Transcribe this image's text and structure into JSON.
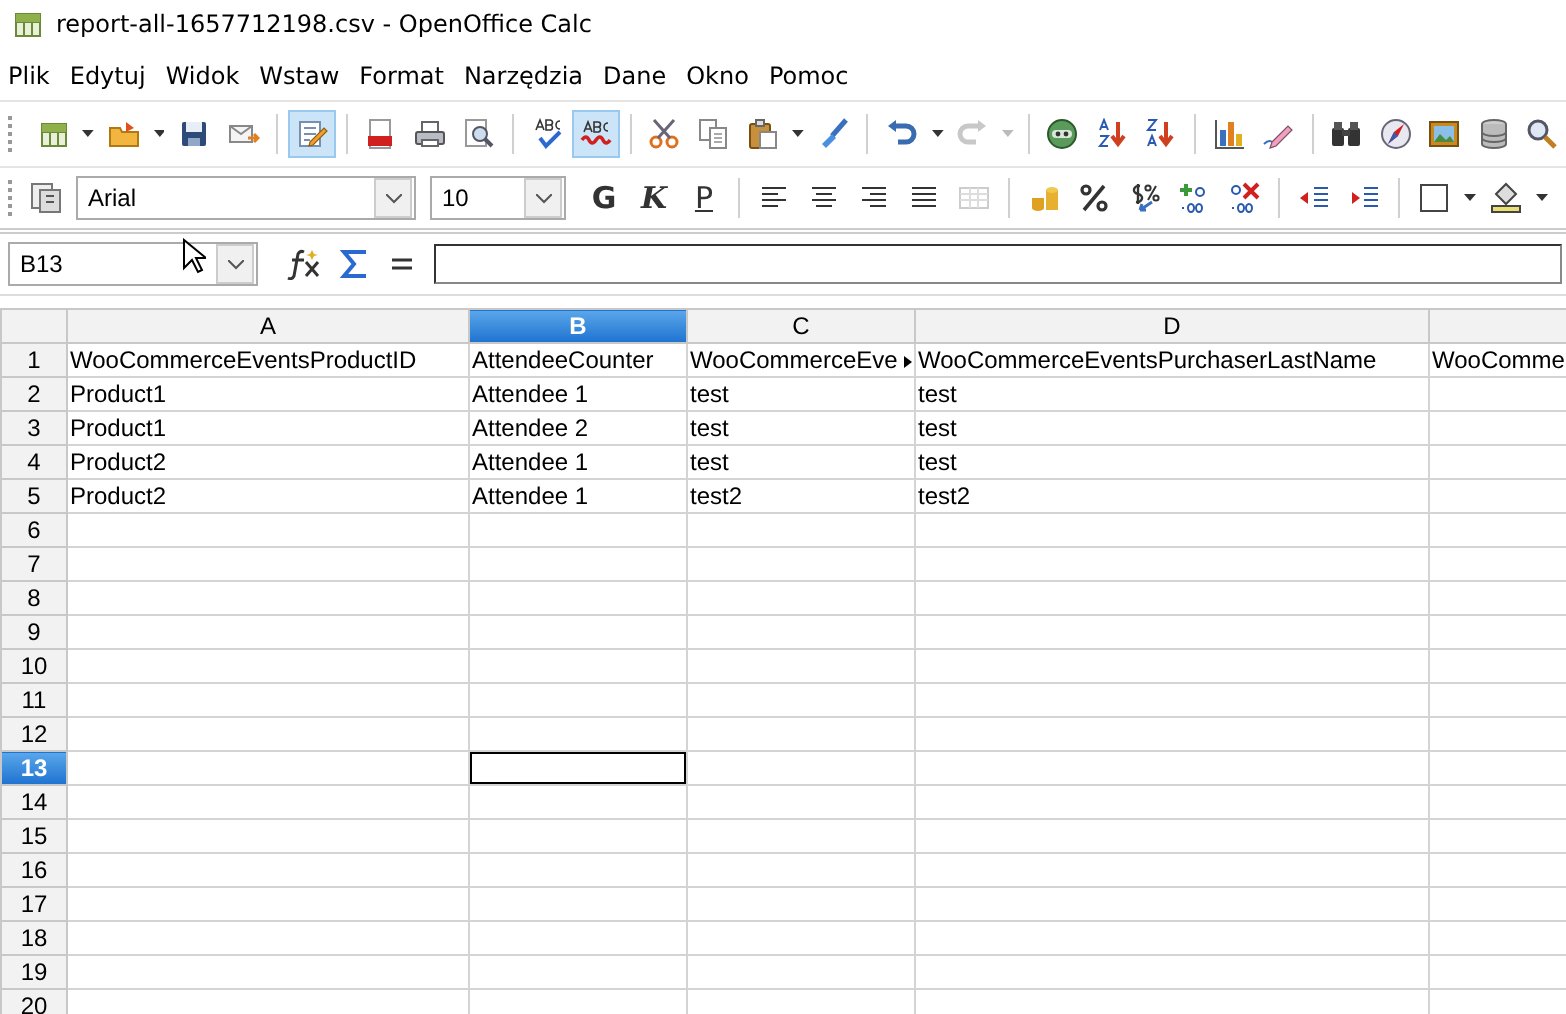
{
  "window": {
    "title": "report-all-1657712198.csv - OpenOffice Calc"
  },
  "menu": [
    {
      "label": "Plik"
    },
    {
      "label": "Edytuj"
    },
    {
      "label": "Widok"
    },
    {
      "label": "Wstaw"
    },
    {
      "label": "Format"
    },
    {
      "label": "Narzędzia"
    },
    {
      "label": "Dane"
    },
    {
      "label": "Okno"
    },
    {
      "label": "Pomoc"
    }
  ],
  "standard_toolbar": {
    "edit_mode": true,
    "auto_spellcheck": true
  },
  "formatting_toolbar": {
    "font": "Arial",
    "size": "10",
    "bold": "G",
    "italic": "K",
    "underline": "P"
  },
  "formula_bar": {
    "name_box": "B13"
  },
  "grid": {
    "columns": [
      {
        "label": "A",
        "selected": false
      },
      {
        "label": "B",
        "selected": true
      },
      {
        "label": "C",
        "selected": false
      },
      {
        "label": "D",
        "selected": false
      },
      {
        "selected": false
      }
    ],
    "rows": [
      {
        "label": "1",
        "selected": false,
        "cells": [
          "WooCommerceEventsProductID",
          "AttendeeCounter",
          "WooCommerceEve",
          "WooCommerceEventsPurchaserLastName",
          "WooComme"
        ]
      },
      {
        "label": "2",
        "selected": false,
        "cells": [
          "Product1",
          "Attendee 1",
          "test",
          "test",
          ""
        ]
      },
      {
        "label": "3",
        "selected": false,
        "cells": [
          "Product1",
          "Attendee 2",
          "test",
          "test",
          ""
        ]
      },
      {
        "label": "4",
        "selected": false,
        "cells": [
          "Product2",
          "Attendee 1",
          "test",
          "test",
          ""
        ]
      },
      {
        "label": "5",
        "selected": false,
        "cells": [
          "Product2",
          "Attendee 1",
          "test2",
          "test2",
          ""
        ]
      },
      {
        "label": "6",
        "selected": false,
        "cells": [
          "",
          "",
          "",
          "",
          ""
        ]
      },
      {
        "label": "7",
        "selected": false,
        "cells": [
          "",
          "",
          "",
          "",
          ""
        ]
      },
      {
        "label": "8",
        "selected": false,
        "cells": [
          "",
          "",
          "",
          "",
          ""
        ]
      },
      {
        "label": "9",
        "selected": false,
        "cells": [
          "",
          "",
          "",
          "",
          ""
        ]
      },
      {
        "label": "10",
        "selected": false,
        "cells": [
          "",
          "",
          "",
          "",
          ""
        ]
      },
      {
        "label": "11",
        "selected": false,
        "cells": [
          "",
          "",
          "",
          "",
          ""
        ]
      },
      {
        "label": "12",
        "selected": false,
        "cells": [
          "",
          "",
          "",
          "",
          ""
        ]
      },
      {
        "label": "13",
        "selected": true,
        "cells": [
          "",
          "",
          "",
          "",
          ""
        ]
      },
      {
        "label": "14",
        "selected": false,
        "cells": [
          "",
          "",
          "",
          "",
          ""
        ]
      },
      {
        "label": "15",
        "selected": false,
        "cells": [
          "",
          "",
          "",
          "",
          ""
        ]
      },
      {
        "label": "16",
        "selected": false,
        "cells": [
          "",
          "",
          "",
          "",
          ""
        ]
      },
      {
        "label": "17",
        "selected": false,
        "cells": [
          "",
          "",
          "",
          "",
          ""
        ]
      },
      {
        "label": "18",
        "selected": false,
        "cells": [
          "",
          "",
          "",
          "",
          ""
        ]
      },
      {
        "label": "19",
        "selected": false,
        "cells": [
          "",
          "",
          "",
          "",
          ""
        ]
      },
      {
        "label": "20",
        "selected": false,
        "cells": [
          "",
          "",
          "",
          "",
          ""
        ]
      }
    ]
  }
}
